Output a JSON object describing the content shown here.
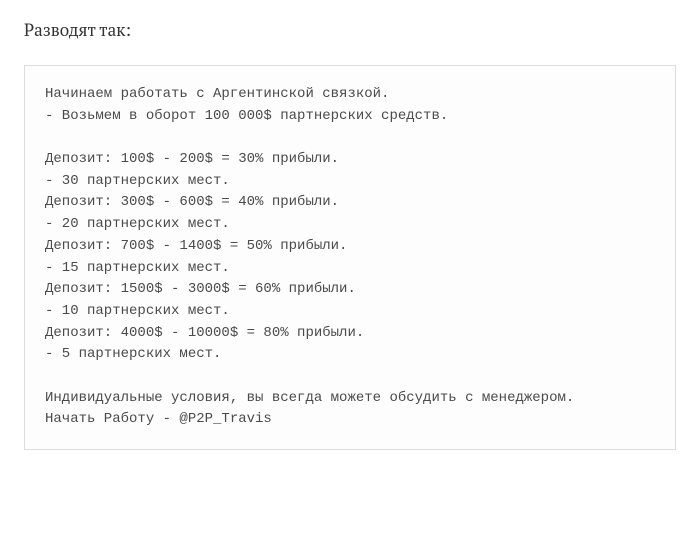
{
  "heading": "Разводят так:",
  "code_text": "Начинаем работать с Аргентинской связкой.\n- Возьмем в оборот 100 000$ партнерских средств.\n\nДепозит: 100$ - 200$ = 30% прибыли.\n- 30 партнерских мест.\nДепозит: 300$ - 600$ = 40% прибыли.\n- 20 партнерских мест.\nДепозит: 700$ - 1400$ = 50% прибыли.\n- 15 партнерских мест.\nДепозит: 1500$ - 3000$ = 60% прибыли.\n- 10 партнерских мест.\nДепозит: 4000$ - 10000$ = 80% прибыли.\n- 5 партнерских мест.\n\nИндивидуальные условия, вы всегда можете обсудить с менеджером.\nНачать Работу - @P2P_Travis"
}
